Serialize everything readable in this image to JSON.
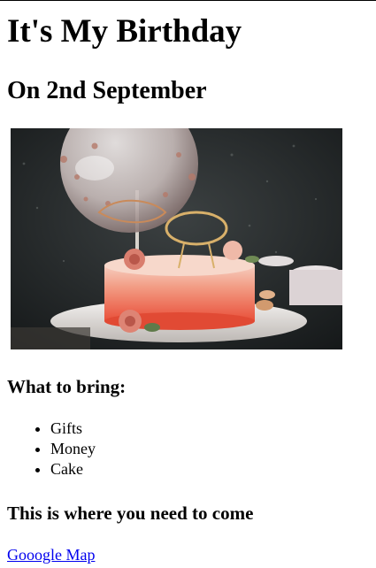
{
  "page": {
    "title": "It's My Birthday",
    "subtitle": "On 2nd September"
  },
  "bring": {
    "heading": "What to bring:",
    "items": [
      {
        "label": "Gifts"
      },
      {
        "label": "Money"
      },
      {
        "label": "Cake"
      }
    ]
  },
  "location": {
    "heading": "This is where you need to come",
    "link_text": "Gooogle Map"
  },
  "image": {
    "alt": "Birthday cake with balloon and Happy Birthday topper"
  },
  "colors": {
    "link": "#0000ee",
    "text": "#000000",
    "background": "#ffffff"
  }
}
